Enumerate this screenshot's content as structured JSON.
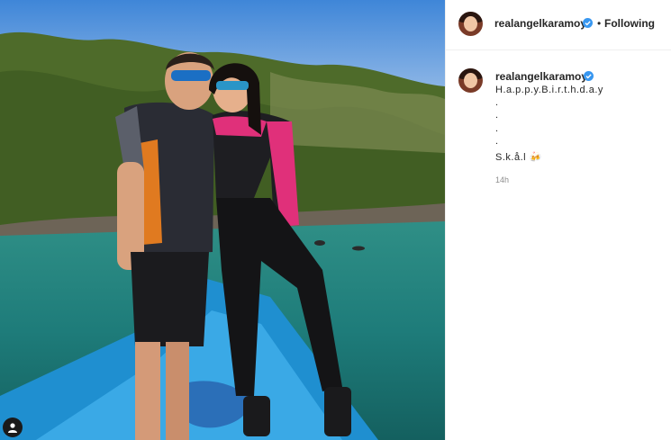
{
  "post": {
    "username": "realangelkaramoy",
    "follow_state": "Following",
    "separator": "•",
    "caption_lines": [
      "H.a.p.p.y.B.i.r.t.h.d.a.y",
      ".",
      ".",
      ".",
      ".",
      "S.k.å.l 🍻"
    ],
    "time_ago": "14h"
  },
  "icons": {
    "verified": "verified-badge-icon",
    "tag": "user-tag-icon"
  },
  "colors": {
    "verified_blue": "#3897f0",
    "text": "#262626",
    "muted": "#8e8e8e"
  }
}
